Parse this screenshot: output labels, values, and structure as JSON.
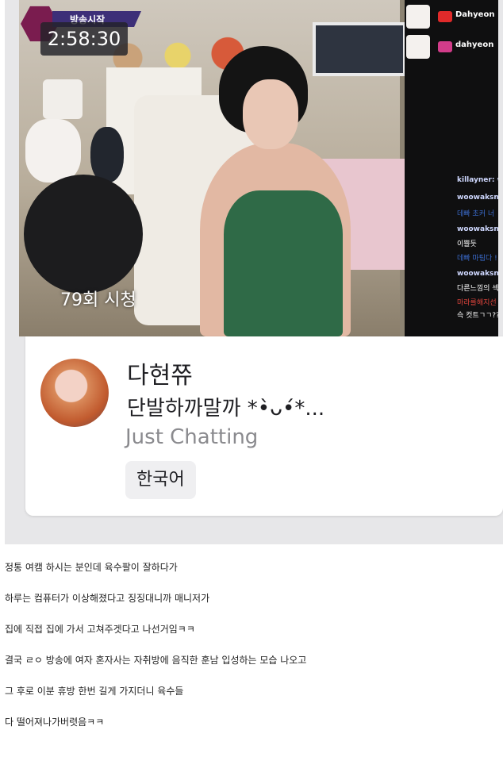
{
  "video": {
    "live_badge": "방송시작",
    "timer": "2:58:30",
    "views": "79회 시청",
    "sns": [
      {
        "icon": "youtube-icon",
        "handle": "Dahyeon",
        "color": "#e02a2a"
      },
      {
        "icon": "instagram-icon",
        "handle": "dahyeon",
        "color": "#d23c8a"
      }
    ],
    "chat": [
      {
        "style": "name",
        "text": "killayner: w"
      },
      {
        "style": "name",
        "text": "woowaksniper"
      },
      {
        "style": "blue",
        "text": "데빠 초커 너"
      },
      {
        "style": "name",
        "text": "woowaksniper"
      },
      {
        "style": "plain",
        "text": "이쁠듯"
      },
      {
        "style": "blue",
        "text": "데빠 마팀다 !"
      },
      {
        "style": "name",
        "text": "woowaksniper"
      },
      {
        "style": "plain",
        "text": "다른느낌의 섹시"
      },
      {
        "style": "red",
        "text": "마라를해지선 저"
      },
      {
        "style": "plain",
        "text": "슥 컷트ㄱㄱ??"
      }
    ]
  },
  "card": {
    "streamer_name": "다현쮸",
    "stream_title": "단발하까말까 *•̀ᴗ•́*...",
    "category": "Just Chatting",
    "tag": "한국어"
  },
  "post": {
    "lines": [
      "정통 여캠 하시는 분인데 육수팔이 잘하다가",
      "하루는 컴퓨터가 이상해졌다고 징징대니까 매니저가",
      "집에 직접 집에 가서 고쳐주겟다고 나선거임ㅋㅋ",
      "결국 ㄹㅇ 방송에 여자 혼자사는 자취방에 음직한 훈남 입성하는 모습 나오고",
      "그 후로 이분 휴방 한번 길게 가지더니 육수들",
      "다 떨어져나가버렷음ㅋㅋ"
    ]
  }
}
